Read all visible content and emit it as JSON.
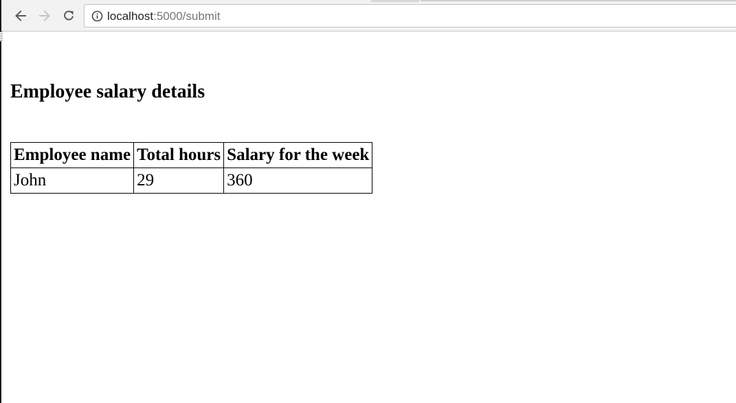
{
  "browser": {
    "url_host": "localhost",
    "url_rest": ":5000/submit"
  },
  "page": {
    "title": "Employee salary details",
    "table": {
      "headers": [
        "Employee name",
        "Total hours",
        "Salary for the week"
      ],
      "rows": [
        [
          "John",
          "29",
          "360"
        ]
      ]
    }
  },
  "icons": {
    "back": "back-arrow-icon",
    "forward": "forward-arrow-icon",
    "reload": "reload-icon",
    "info": "info-icon"
  }
}
